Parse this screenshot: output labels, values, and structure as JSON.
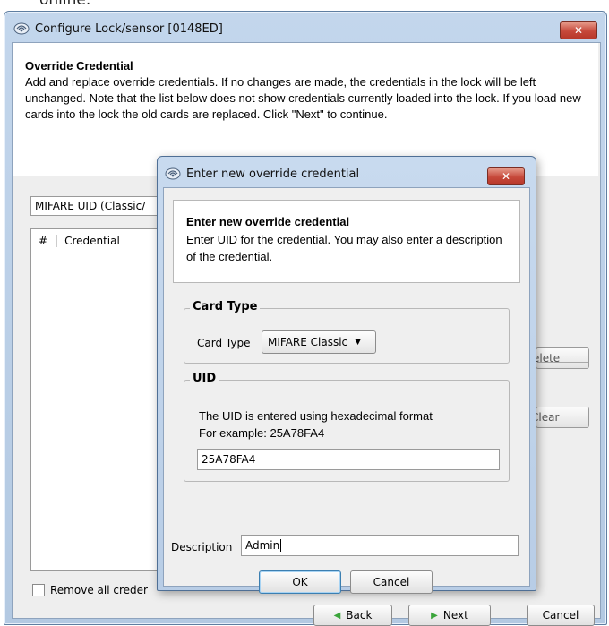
{
  "background_text": "online.",
  "main": {
    "title": "Configure Lock/sensor [0148ED]",
    "close_label": "✕",
    "info_title": "Override Credential",
    "info_text": "Add and replace override credentials. If no changes are made, the credentials in the lock will be left unchanged. Note that the list below does not show credentials currently loaded into the lock. If you load new cards into the lock the old cards are replaced. Click \"Next\" to continue.",
    "type_select": "MIFARE UID (Classic/",
    "list_columns": [
      "#",
      "Credential"
    ],
    "delete_label": "elete",
    "clear_label": "Clear",
    "remove_all_label": "Remove all creder",
    "back_label": "Back",
    "next_label": "Next",
    "cancel_label": "Cancel"
  },
  "dialog": {
    "title": "Enter new override credential",
    "close_label": "✕",
    "info_title": "Enter new override credential",
    "info_text": "Enter UID for the credential. You may also enter a description of the credential.",
    "card_type_group": "Card Type",
    "card_type_label": "Card Type",
    "card_type_value": "MIFARE Classic",
    "uid_group": "UID",
    "uid_help_line1": "The UID is entered using hexadecimal format",
    "uid_help_line2": "For example: 25A78FA4",
    "uid_value": "25A78FA4",
    "description_label": "Description",
    "description_value": "Admin",
    "ok_label": "OK",
    "cancel_label": "Cancel"
  },
  "colors": {
    "title_bar": "#c3d6ec",
    "close_button": "#c6483a",
    "nav_arrow": "#3aa43a"
  },
  "icons": {
    "window_icon": "lock-sensor-icon",
    "back_icon": "arrow-left-icon",
    "next_icon": "arrow-right-icon",
    "dropdown_icon": "chevron-down-icon"
  }
}
